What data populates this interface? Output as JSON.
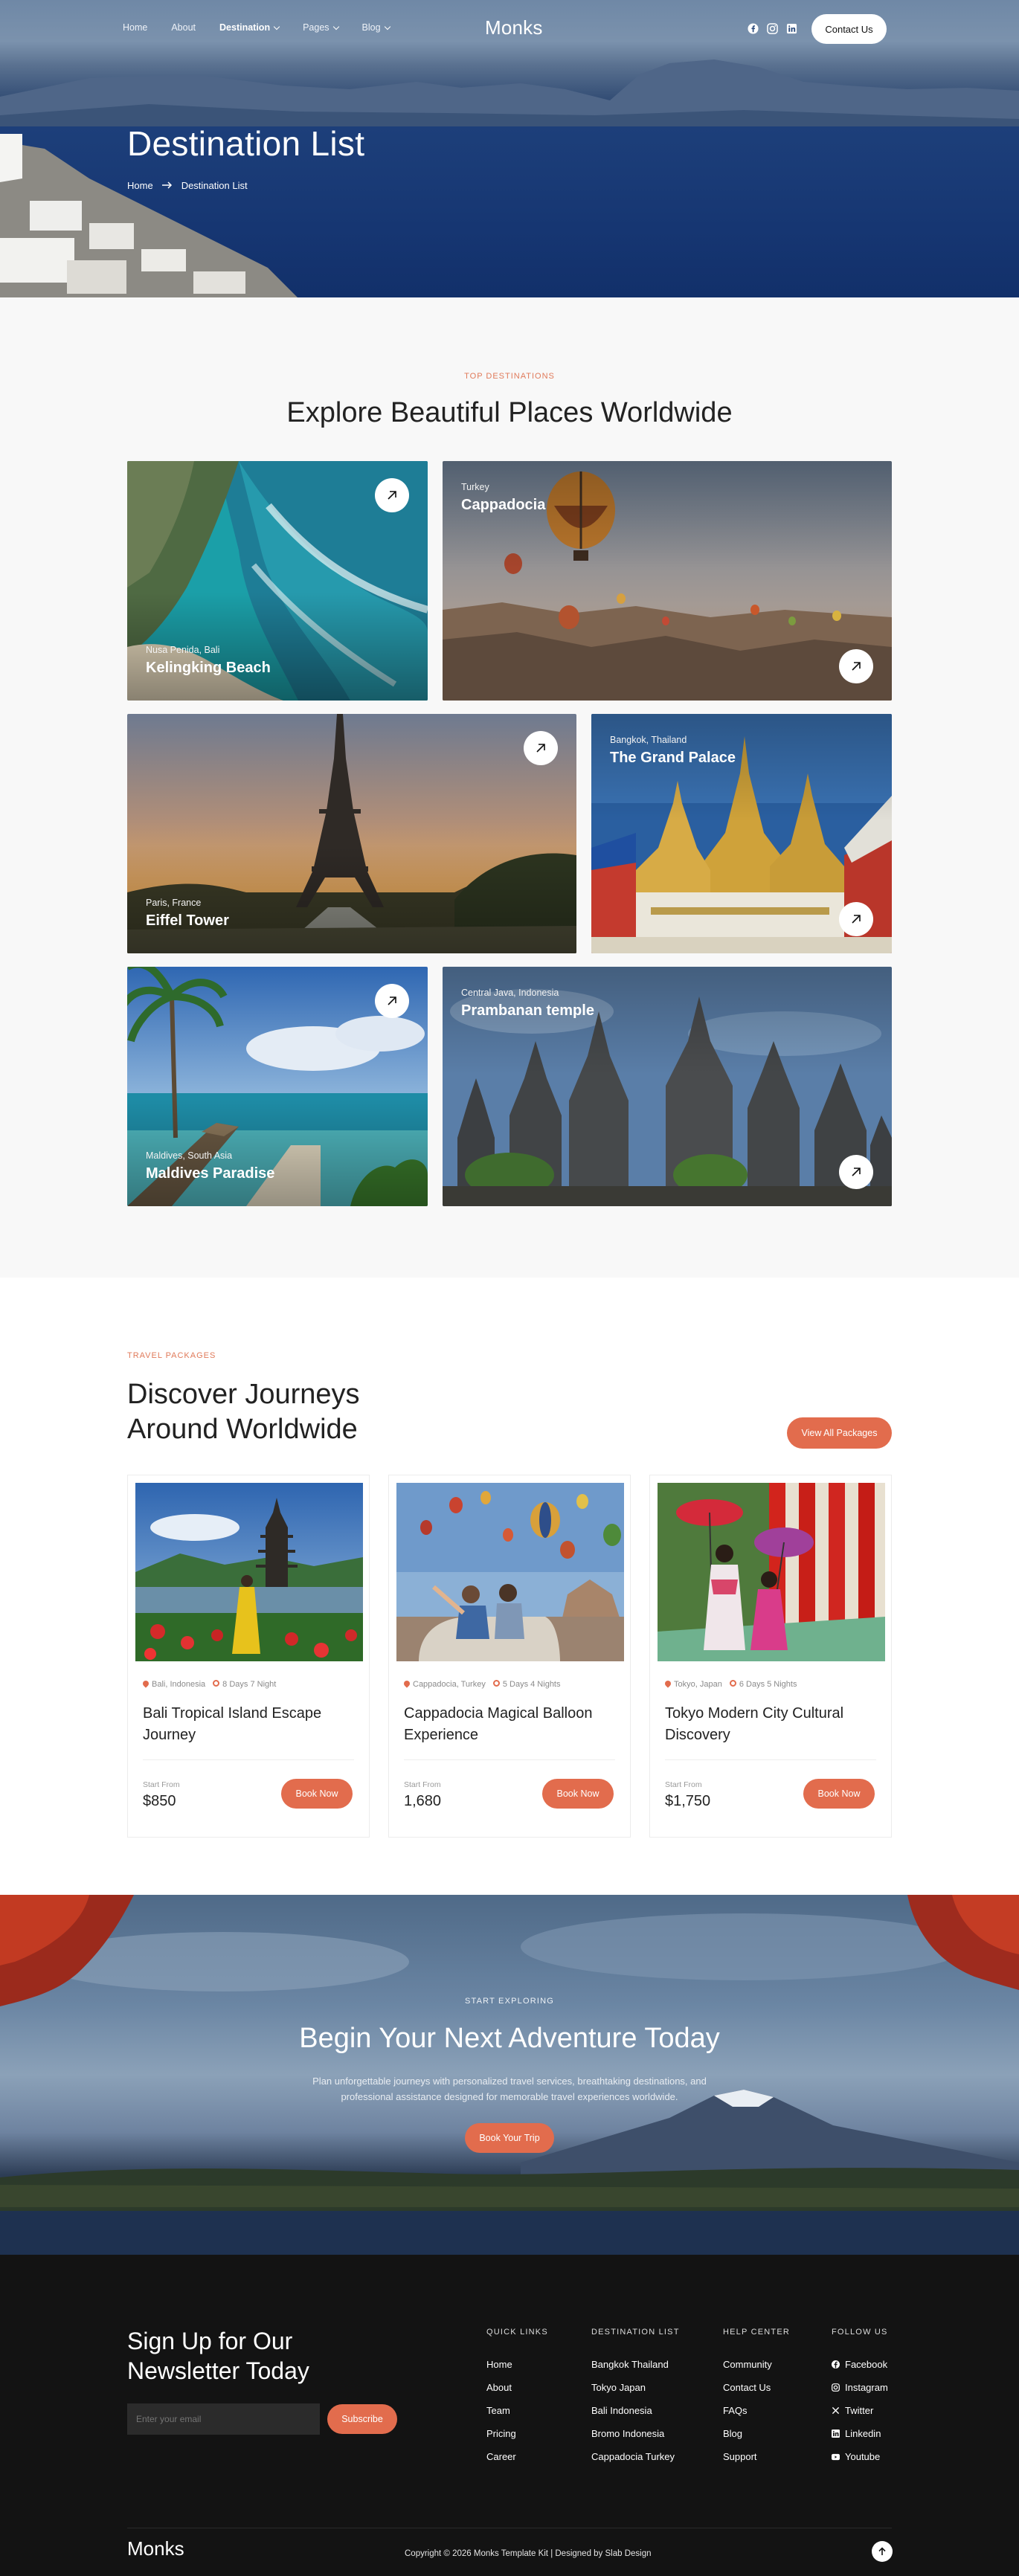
{
  "nav": {
    "links": [
      {
        "label": "Home",
        "dropdown": false
      },
      {
        "label": "About",
        "dropdown": false
      },
      {
        "label": "Destination",
        "dropdown": true
      },
      {
        "label": "Pages",
        "dropdown": true
      },
      {
        "label": "Blog",
        "dropdown": true
      }
    ],
    "logo": "Monks",
    "social_icons": [
      "facebook-icon",
      "instagram-icon",
      "linkedin-icon"
    ],
    "contact_label": "Contact Us"
  },
  "hero": {
    "title": "Destination List",
    "breadcrumb": {
      "home": "Home",
      "current": "Destination List"
    }
  },
  "destinations": {
    "eyebrow": "TOP DESTINATIONS",
    "title": "Explore Beautiful Places Worldwide",
    "cards": [
      {
        "location": "Nusa Penida, Bali",
        "title": "Kelingking Beach"
      },
      {
        "location": "Turkey",
        "title": "Cappadocia"
      },
      {
        "location": "Paris, France",
        "title": "Eiffel Tower"
      },
      {
        "location": "Bangkok, Thailand",
        "title": "The Grand Palace"
      },
      {
        "location": "Maldives, South Asia",
        "title": "Maldives Paradise"
      },
      {
        "location": "Central Java, Indonesia",
        "title": "Prambanan temple"
      }
    ]
  },
  "packages": {
    "eyebrow": "TRAVEL PACKAGES",
    "title_line1": "Discover Journeys",
    "title_line2": "Around Worldwide",
    "view_all_label": "View All Packages",
    "items": [
      {
        "location": "Bali, Indonesia",
        "duration": "8 Days 7 Night",
        "name": "Bali Tropical Island Escape Journey",
        "start_label": "Start From",
        "price": "$850",
        "book_label": "Book Now"
      },
      {
        "location": "Cappadocia, Turkey",
        "duration": "5 Days 4 Nights",
        "name": "Cappadocia Magical Balloon Experience",
        "start_label": "Start From",
        "price": "1,680",
        "book_label": "Book Now"
      },
      {
        "location": "Tokyo, Japan",
        "duration": "6 Days 5 Nights",
        "name": "Tokyo Modern City Cultural Discovery",
        "start_label": "Start From",
        "price": "$1,750",
        "book_label": "Book Now"
      }
    ]
  },
  "cta": {
    "eyebrow": "START EXPLORING",
    "title": "Begin Your Next Adventure Today",
    "text_line1": "Plan unforgettable journeys with personalized travel services, breathtaking destinations, and",
    "text_line2": "professional assistance designed for memorable travel experiences worldwide.",
    "button_label": "Book Your Trip"
  },
  "footer": {
    "newsletter_line1": "Sign Up for Our",
    "newsletter_line2": "Newsletter Today",
    "email_placeholder": "Enter your email",
    "subscribe_label": "Subscribe",
    "columns": [
      {
        "heading": "QUICK LINKS",
        "items": [
          "Home",
          "About",
          "Team",
          "Pricing",
          "Career"
        ]
      },
      {
        "heading": "DESTINATION LIST",
        "items": [
          "Bangkok Thailand",
          "Tokyo Japan",
          "Bali Indonesia",
          "Bromo Indonesia",
          "Cappadocia Turkey"
        ]
      },
      {
        "heading": "HELP CENTER",
        "items": [
          "Community",
          "Contact Us",
          "FAQs",
          "Blog",
          "Support"
        ]
      }
    ],
    "follow": {
      "heading": "FOLLOW US",
      "items": [
        {
          "label": "Facebook",
          "icon": "facebook-icon"
        },
        {
          "label": "Instagram",
          "icon": "instagram-icon"
        },
        {
          "label": "Twitter",
          "icon": "x-twitter-icon"
        },
        {
          "label": "Linkedin",
          "icon": "linkedin-icon"
        },
        {
          "label": "Youtube",
          "icon": "youtube-icon"
        }
      ]
    },
    "logo": "Monks",
    "copyright": "Copyright © 2026 Monks Template Kit | Designed by Slab Design"
  },
  "colors": {
    "accent": "#e26c4d",
    "footer_bg": "#131313",
    "hero_sea": "#1a3a72"
  }
}
